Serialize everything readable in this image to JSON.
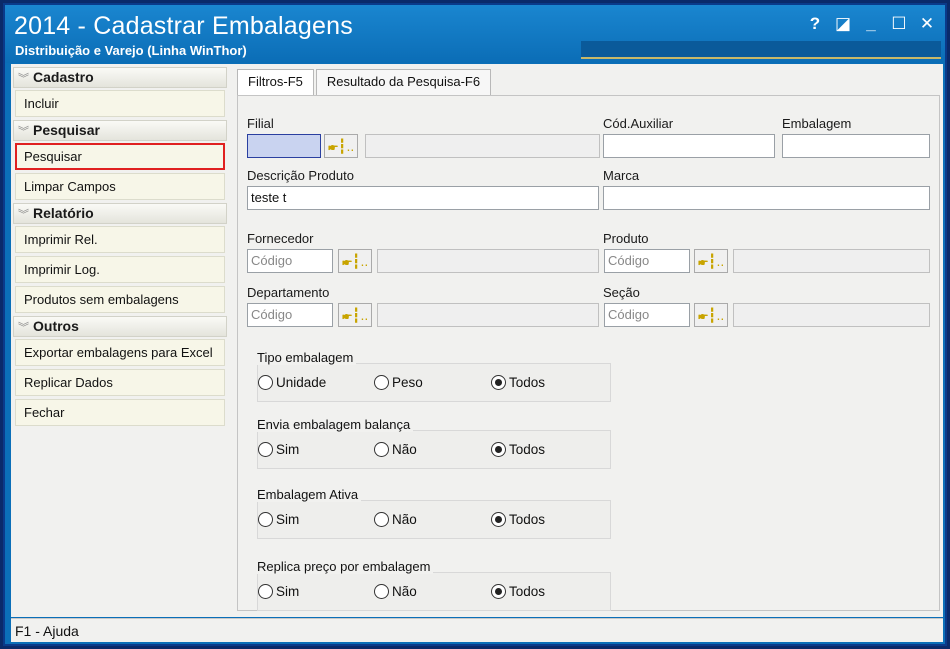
{
  "window": {
    "title": "2014 - Cadastrar Embalagens",
    "subtitle": "Distribuição e Varejo (Linha WinThor)",
    "buttons": {
      "help": "?",
      "restore": "◪",
      "minimize": "_",
      "maximize": "☐",
      "close": "✕"
    }
  },
  "sidebar": {
    "groups": [
      {
        "title": "Cadastro",
        "items": [
          "Incluir"
        ]
      },
      {
        "title": "Pesquisar",
        "items": [
          "Pesquisar",
          "Limpar Campos"
        ]
      },
      {
        "title": "Relatório",
        "items": [
          "Imprimir Rel.",
          "Imprimir Log.",
          "Produtos sem embalagens"
        ]
      },
      {
        "title": "Outros",
        "items": [
          "Exportar embalagens para Excel",
          "Replicar Dados",
          "Fechar"
        ]
      }
    ]
  },
  "tabs": {
    "filtros": "Filtros-F5",
    "resultado": "Resultado da Pesquisa-F6"
  },
  "form": {
    "filial": {
      "label": "Filial",
      "value": "",
      "lookup": "🖝┇.."
    },
    "cod_auxiliar": {
      "label": "Cód.Auxiliar",
      "value": ""
    },
    "embalagem": {
      "label": "Embalagem",
      "value": ""
    },
    "descricao": {
      "label": "Descrição Produto",
      "value": "teste t"
    },
    "marca": {
      "label": "Marca",
      "value": ""
    },
    "fornecedor": {
      "label": "Fornecedor",
      "placeholder": "Código"
    },
    "produto": {
      "label": "Produto",
      "placeholder": "Código"
    },
    "departamento": {
      "label": "Departamento",
      "placeholder": "Código"
    },
    "secao": {
      "label": "Seção",
      "placeholder": "Código"
    }
  },
  "radio_groups": [
    {
      "title": "Tipo embalagem",
      "options": [
        "Unidade",
        "Peso",
        "Todos"
      ],
      "selected": 2
    },
    {
      "title": "Envia embalagem balança",
      "options": [
        "Sim",
        "Não",
        "Todos"
      ],
      "selected": 2
    },
    {
      "title": "Embalagem Ativa",
      "options": [
        "Sim",
        "Não",
        "Todos"
      ],
      "selected": 2
    },
    {
      "title": "Replica preço por embalagem",
      "options": [
        "Sim",
        "Não",
        "Todos"
      ],
      "selected": 2
    }
  ],
  "status": {
    "help": "F1 - Ajuda"
  },
  "colors": {
    "titlebar": "#0b6fb8",
    "highlight": "#e02020",
    "active_input": "#c9d3f0"
  }
}
